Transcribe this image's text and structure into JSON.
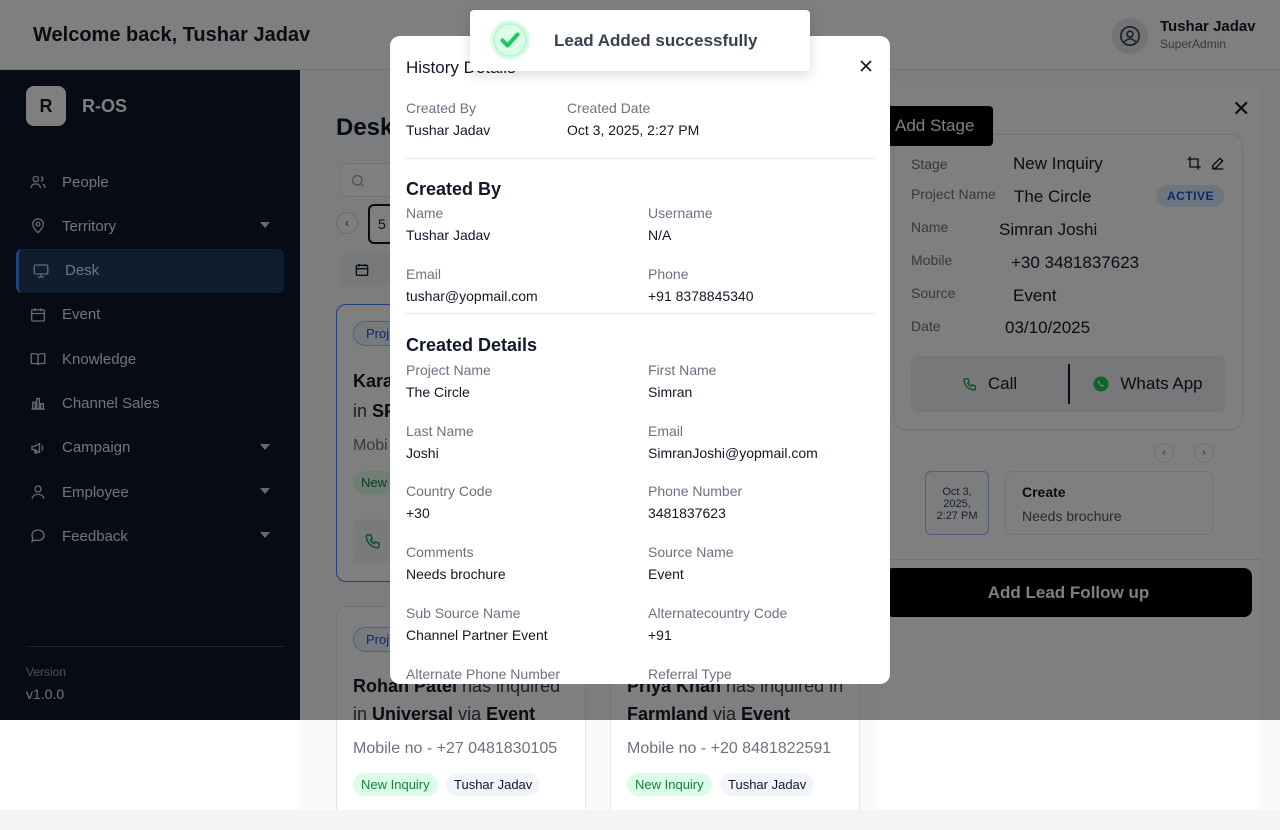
{
  "header": {
    "welcome": "Welcome back, Tushar Jadav",
    "user_name": "Tushar Jadav",
    "user_role": "SuperAdmin"
  },
  "sidebar": {
    "logo_letter": "R",
    "logo_text": "R-OS",
    "items": [
      {
        "label": "People",
        "icon": "people-icon",
        "caret": false
      },
      {
        "label": "Territory",
        "icon": "location-pin-icon",
        "caret": true
      },
      {
        "label": "Desk",
        "icon": "monitor-icon",
        "caret": false,
        "active": true
      },
      {
        "label": "Event",
        "icon": "calendar-icon",
        "caret": false
      },
      {
        "label": "Knowledge",
        "icon": "book-icon",
        "caret": false
      },
      {
        "label": "Channel Sales",
        "icon": "bar-chart-icon",
        "caret": false
      },
      {
        "label": "Campaign",
        "icon": "megaphone-icon",
        "caret": true
      },
      {
        "label": "Employee",
        "icon": "user-icon",
        "caret": true
      },
      {
        "label": "Feedback",
        "icon": "chat-bubble-icon",
        "caret": true
      }
    ],
    "version_label": "Version",
    "version_value": "v1.0.0"
  },
  "main": {
    "title": "Desk",
    "pager_current": "5",
    "cards": [
      {
        "project_chip": "Proj",
        "line1_name": "Kara",
        "line2_project": "SP",
        "mobile": "Mobi",
        "stage": "New"
      },
      {
        "project_chip": "Proj",
        "line1_name": "Rohan Patel",
        "line1_verb": " has inquired",
        "line2_in": "in ",
        "line2_project": "Universal",
        "line2_via": " via ",
        "line2_source": "Event",
        "mobile": "Mobile no - +27 0481830105",
        "stage": "New Inquiry",
        "owner": "Tushar Jadav"
      },
      {
        "line1_name": "Priya Khan",
        "line1_verb": " has inquired in",
        "line2_project": "Farmland",
        "line2_via": " via ",
        "line2_source": "Event",
        "mobile": "Mobile no - +20 8481822591",
        "stage": "New Inquiry",
        "owner": "Tushar Jadav"
      }
    ]
  },
  "drawer": {
    "add_stage": "Add Stage",
    "fields": {
      "stage_label": "Stage",
      "stage_value": "New Inquiry",
      "project_label": "Project Name",
      "project_value": "The Circle",
      "name_label": "Name",
      "name_value": "Simran Joshi",
      "mobile_label": "Mobile",
      "mobile_value": "+30 3481837623",
      "source_label": "Source",
      "source_value": "Event",
      "date_label": "Date",
      "date_value": "03/10/2025"
    },
    "status_badge": "ACTIVE",
    "call_label": "Call",
    "whatsapp_label": "Whats App",
    "history_date_lines": [
      "Oct 3,",
      "2025,",
      "2:27 PM"
    ],
    "history_title": "Create",
    "history_note": "Needs brochure",
    "followup_button": "Add Lead Follow up"
  },
  "modal": {
    "title": "History Details",
    "summary": {
      "created_by_label": "Created By",
      "created_by_value": "Tushar Jadav",
      "created_date_label": "Created Date",
      "created_date_value": "Oct 3, 2025, 2:27 PM"
    },
    "created_by_section": {
      "title": "Created By",
      "name_label": "Name",
      "name_value": "Tushar Jadav",
      "username_label": "Username",
      "username_value": "N/A",
      "email_label": "Email",
      "email_value": "tushar@yopmail.com",
      "phone_label": "Phone",
      "phone_value": "+91 8378845340"
    },
    "details_section": {
      "title": "Created Details",
      "fields": [
        {
          "label": "Project Name",
          "value": "The Circle"
        },
        {
          "label": "First Name",
          "value": "Simran"
        },
        {
          "label": "Last Name",
          "value": "Joshi"
        },
        {
          "label": "Email",
          "value": "SimranJoshi@yopmail.com"
        },
        {
          "label": "Country Code",
          "value": "+30"
        },
        {
          "label": "Phone Number",
          "value": "3481837623"
        },
        {
          "label": "Comments",
          "value": "Needs brochure"
        },
        {
          "label": "Source Name",
          "value": "Event"
        },
        {
          "label": "Sub Source Name",
          "value": "Channel Partner Event"
        },
        {
          "label": "Alternatecountry Code",
          "value": "+91"
        },
        {
          "label": "Alternate Phone Number",
          "value": ""
        },
        {
          "label": "Referral Type",
          "value": ""
        }
      ]
    }
  },
  "toast": {
    "message": "Lead Added successfully",
    "icon": "check-circle-icon"
  },
  "colors": {
    "sidebar_bg": "#0f172a",
    "active_item": "#1e3a5f",
    "accent": "#3b82f6",
    "success": "#22c55e"
  }
}
